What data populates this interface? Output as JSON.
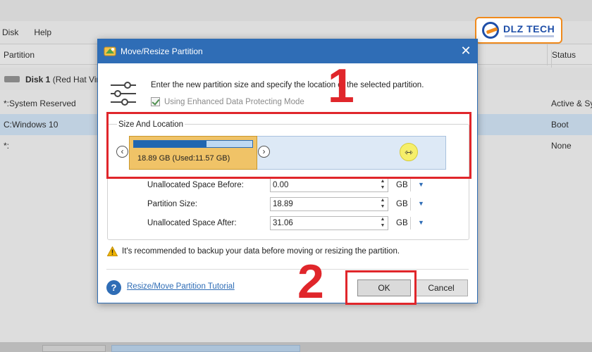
{
  "background": {
    "menu": [
      "Disk",
      "Help"
    ],
    "columns": {
      "partition": "Partition",
      "status": "Status"
    },
    "disk_row": {
      "name": "Disk 1",
      "detail": "(Red Hat Virt"
    },
    "partitions": [
      {
        "name": "*:System Reserved",
        "status": "Active & Sy",
        "selected": false
      },
      {
        "name": "C:Windows 10",
        "status": "Boot",
        "selected": true
      },
      {
        "name": "*:",
        "status": "None",
        "selected": false
      }
    ]
  },
  "logo": {
    "text": "DLZ TECH",
    "colors": {
      "primary": "#1f4fa8",
      "accent": "#f08a1c"
    }
  },
  "dialog": {
    "title": "Move/Resize Partition",
    "close_glyph": "✕",
    "description": "Enter the new partition size and specify the location of the selected partition.",
    "enhanced_mode": {
      "label": "Using Enhanced Data Protecting Mode",
      "checked": true
    },
    "group_title": "Size And Location",
    "partition_graphic": {
      "label": "18.89 GB (Used:11.57 GB)",
      "used_fraction": 0.612
    },
    "left_arrow": "‹",
    "right_arrow": "›",
    "handle_glyph": "⇿",
    "fields": [
      {
        "label": "Unallocated Space Before:",
        "value": "0.00",
        "unit": "GB"
      },
      {
        "label": "Partition Size:",
        "value": "18.89",
        "unit": "GB"
      },
      {
        "label": "Unallocated Space After:",
        "value": "31.06",
        "unit": "GB"
      }
    ],
    "warning": "It's recommended to backup your data before moving or resizing the partition.",
    "help_link": "Resize/Move Partition Tutorial",
    "ok_label": "OK",
    "cancel_label": "Cancel"
  },
  "annotations": {
    "step1": "1",
    "step2": "2",
    "color": "#e0262b"
  }
}
